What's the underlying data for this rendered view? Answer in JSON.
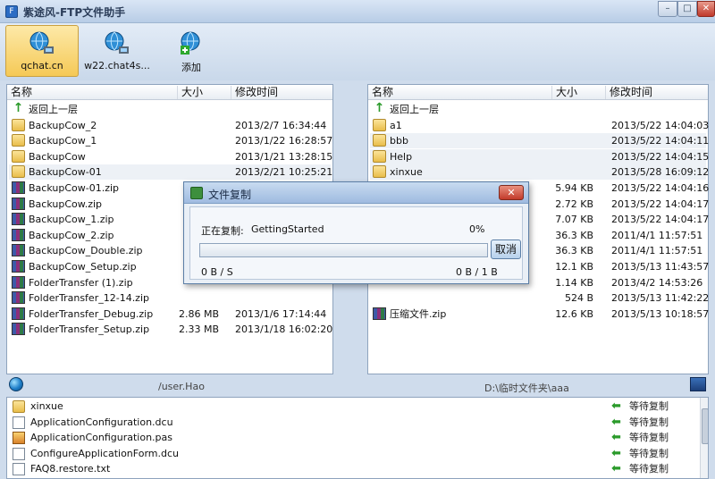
{
  "window": {
    "title": "紫途风-FTP文件助手",
    "min": "–",
    "max": "□",
    "close": "✕"
  },
  "toolbar": [
    {
      "label": "qchat.cn",
      "icon": "network-globe-icon"
    },
    {
      "label": "w22.chat4s...",
      "icon": "network-globe-icon"
    },
    {
      "label": "添加",
      "icon": "add-connection-icon"
    }
  ],
  "left": {
    "headers": [
      "名称",
      "大小",
      "修改时间"
    ],
    "up": "返回上一层",
    "files": [
      {
        "name": "BackupCow_2",
        "type": "folder",
        "size": "",
        "time": "2013/2/7 16:34:44"
      },
      {
        "name": "BackupCow_1",
        "type": "folder",
        "size": "",
        "time": "2013/1/22 16:28:57"
      },
      {
        "name": "BackupCow",
        "type": "folder",
        "size": "",
        "time": "2013/1/21 13:28:15"
      },
      {
        "name": "BackupCow-01",
        "type": "folder",
        "size": "",
        "time": "2013/2/21 10:25:21"
      },
      {
        "name": "BackupCow-01.zip",
        "type": "zip",
        "size": "",
        "time": ""
      },
      {
        "name": "BackupCow.zip",
        "type": "zip",
        "size": "",
        "time": ""
      },
      {
        "name": "BackupCow_1.zip",
        "type": "zip",
        "size": "",
        "time": ""
      },
      {
        "name": "BackupCow_2.zip",
        "type": "zip",
        "size": "",
        "time": ""
      },
      {
        "name": "BackupCow_Double.zip",
        "type": "zip",
        "size": "",
        "time": ""
      },
      {
        "name": "BackupCow_Setup.zip",
        "type": "zip",
        "size": "",
        "time": ""
      },
      {
        "name": "FolderTransfer (1).zip",
        "type": "zip",
        "size": "",
        "time": ""
      },
      {
        "name": "FolderTransfer_12-14.zip",
        "type": "zip",
        "size": "",
        "time": ""
      },
      {
        "name": "FolderTransfer_Debug.zip",
        "type": "zip",
        "size": "2.86 MB",
        "time": "2013/1/6 17:14:44"
      },
      {
        "name": "FolderTransfer_Setup.zip",
        "type": "zip",
        "size": "2.33 MB",
        "time": "2013/1/18 16:02:20"
      }
    ],
    "path": "/user.Hao"
  },
  "right": {
    "headers": [
      "名称",
      "大小",
      "修改时间"
    ],
    "up": "返回上一层",
    "files": [
      {
        "name": "a1",
        "type": "folder",
        "size": "",
        "time": "2013/5/22 14:04:03"
      },
      {
        "name": "bbb",
        "type": "folder",
        "size": "",
        "time": "2013/5/22 14:04:11"
      },
      {
        "name": "Help",
        "type": "folder",
        "size": "",
        "time": "2013/5/22 14:04:15"
      },
      {
        "name": "xinxue",
        "type": "folder",
        "size": "",
        "time": "2013/5/28 16:09:12"
      },
      {
        "name": "",
        "type": "",
        "size": "5.94 KB",
        "time": "2013/5/22 14:04:16"
      },
      {
        "name": "",
        "type": "",
        "size": "2.72 KB",
        "time": "2013/5/22 14:04:17"
      },
      {
        "name": "",
        "type": "",
        "size": "7.07 KB",
        "time": "2013/5/22 14:04:17"
      },
      {
        "name": "",
        "type": "",
        "size": "36.3 KB",
        "time": "2011/4/1 11:57:51"
      },
      {
        "name": "",
        "type": "",
        "size": "36.3 KB",
        "time": "2011/4/1 11:57:51"
      },
      {
        "name": "",
        "type": "",
        "size": "12.1 KB",
        "time": "2013/5/13 11:43:57"
      },
      {
        "name": "",
        "type": "",
        "size": "1.14 KB",
        "time": "2013/4/2 14:53:26"
      },
      {
        "name": "",
        "type": "",
        "size": "524 B",
        "time": "2013/5/13 11:42:22"
      },
      {
        "name": "压缩文件.zip",
        "type": "zip",
        "size": "12.6 KB",
        "time": "2013/5/13 10:18:57"
      }
    ],
    "path": "D:\\临时文件夹\\aaa"
  },
  "queue": [
    {
      "name": "xinxue",
      "type": "folder",
      "status": "等待复制"
    },
    {
      "name": "ApplicationConfiguration.dcu",
      "type": "doc",
      "status": "等待复制"
    },
    {
      "name": "ApplicationConfiguration.pas",
      "type": "pas",
      "status": "等待复制"
    },
    {
      "name": "ConfigureApplicationForm.dcu",
      "type": "doc",
      "status": "等待复制"
    },
    {
      "name": "FAQ8.restore.txt",
      "type": "doc",
      "status": "等待复制"
    }
  ],
  "dialog": {
    "title": "文件复制",
    "close": "✕",
    "label": "正在复制:",
    "file": "GettingStartedUsing",
    "percent": "0%",
    "progress": 0,
    "bytes_done": "0 B / S",
    "bytes_total": "0 B / 1 B",
    "cancel": "取消"
  }
}
